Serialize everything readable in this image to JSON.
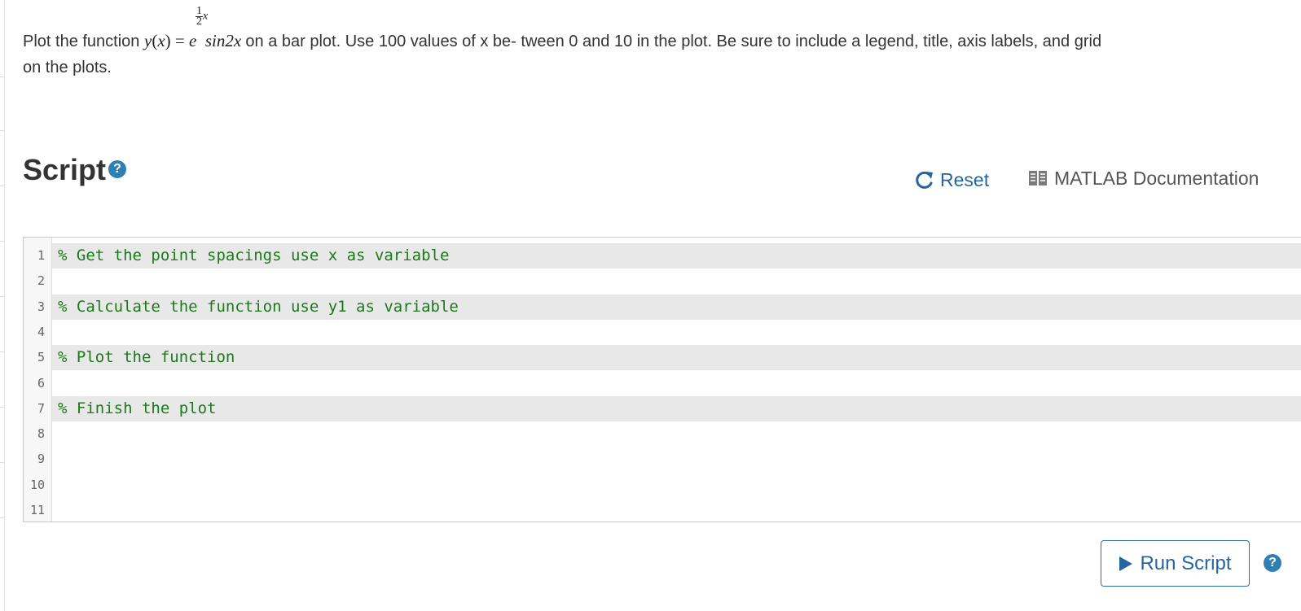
{
  "problem": {
    "prefix": "Plot the function ",
    "math_y": "y",
    "math_x": "x",
    "math_e": "e",
    "exp_num": "1",
    "exp_den": "2",
    "exp_x": "x",
    "sin_text": "sin2",
    "sin_x": "x",
    "suffix_line1": " on a bar plot. Use 100 values of x be- tween 0 and 10 in the plot. Be sure to include a legend, title, axis labels, and grid",
    "line2": "on the plots."
  },
  "script": {
    "title": "Script",
    "help_glyph": "?",
    "reset_label": "Reset",
    "docs_label": "MATLAB Documentation",
    "run_label": "Run Script"
  },
  "editor": {
    "lines": [
      {
        "num": "1",
        "text": "% Get the point spacings use x as variable"
      },
      {
        "num": "2",
        "text": ""
      },
      {
        "num": "3",
        "text": "% Calculate the function use y1 as variable"
      },
      {
        "num": "4",
        "text": ""
      },
      {
        "num": "5",
        "text": "% Plot the function"
      },
      {
        "num": "6",
        "text": ""
      },
      {
        "num": "7",
        "text": "% Finish the plot"
      },
      {
        "num": "8",
        "text": ""
      },
      {
        "num": "9",
        "text": ""
      },
      {
        "num": "10",
        "text": ""
      },
      {
        "num": "11",
        "text": ""
      }
    ]
  },
  "colors": {
    "accent": "#2565a0",
    "comment": "#1a7a1a",
    "highlight_row": "#e8e8e8"
  },
  "icons": {
    "reset": "refresh-icon",
    "docs": "book-icon",
    "run": "play-icon",
    "help": "help-icon"
  }
}
